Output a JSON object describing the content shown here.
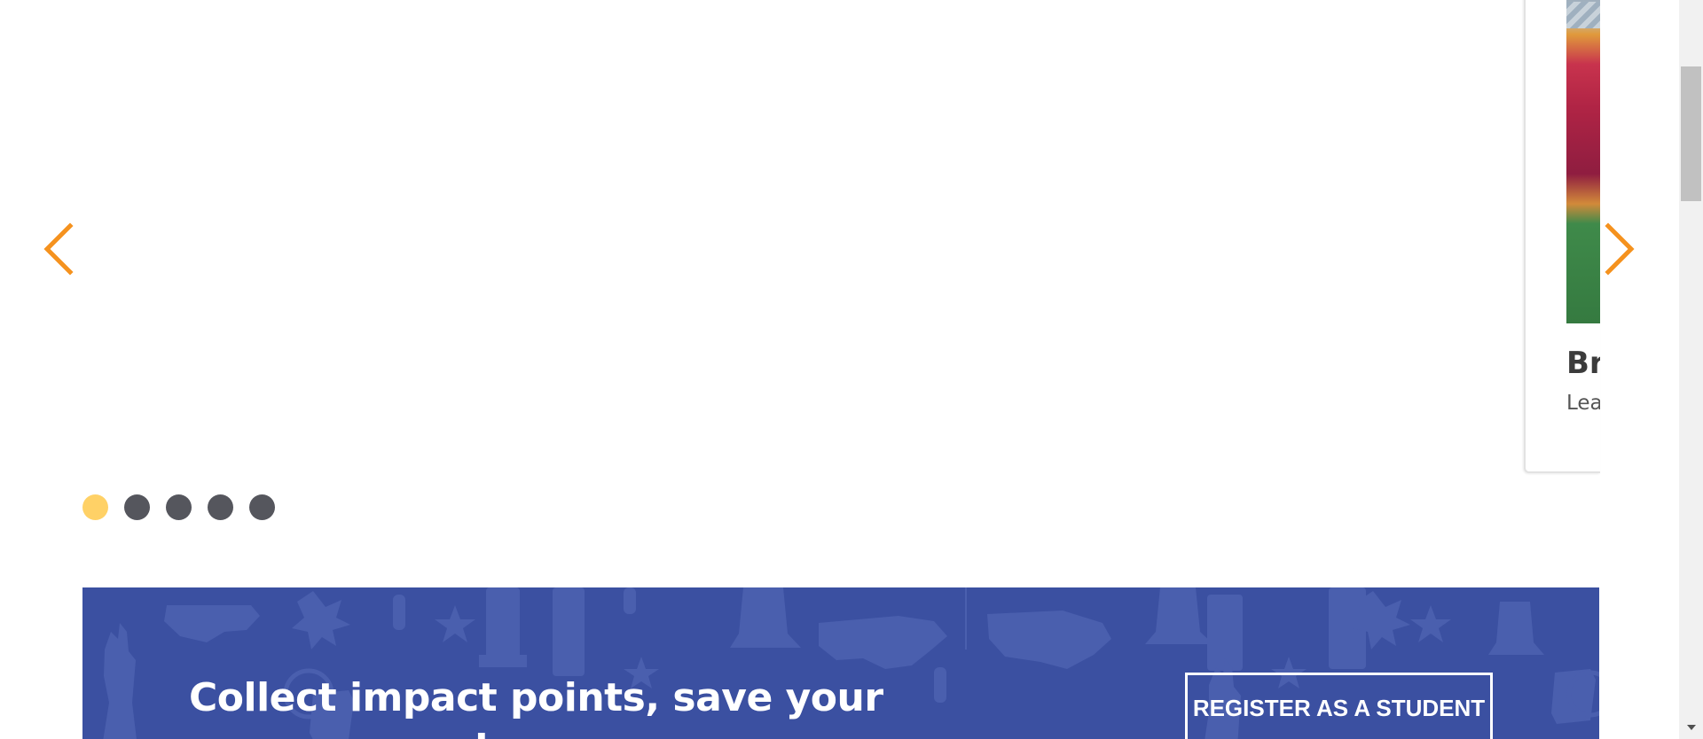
{
  "carousel": {
    "peek_card": {
      "title": "Br",
      "subtitle": "Lea"
    },
    "dots": [
      {
        "active": true
      },
      {
        "active": false
      },
      {
        "active": false
      },
      {
        "active": false
      },
      {
        "active": false
      }
    ],
    "arrow_color": "#f5921e",
    "dot_active_color": "#ffd166",
    "dot_color": "#55565d"
  },
  "banner": {
    "text": "Collect impact points, save your progress, and",
    "button_label": "REGISTER AS A STUDENT",
    "background_color": "#3b50a1"
  },
  "icons": {
    "prev": "chevron-left-icon",
    "next": "chevron-right-icon",
    "scroll_down": "triangle-down-icon"
  }
}
